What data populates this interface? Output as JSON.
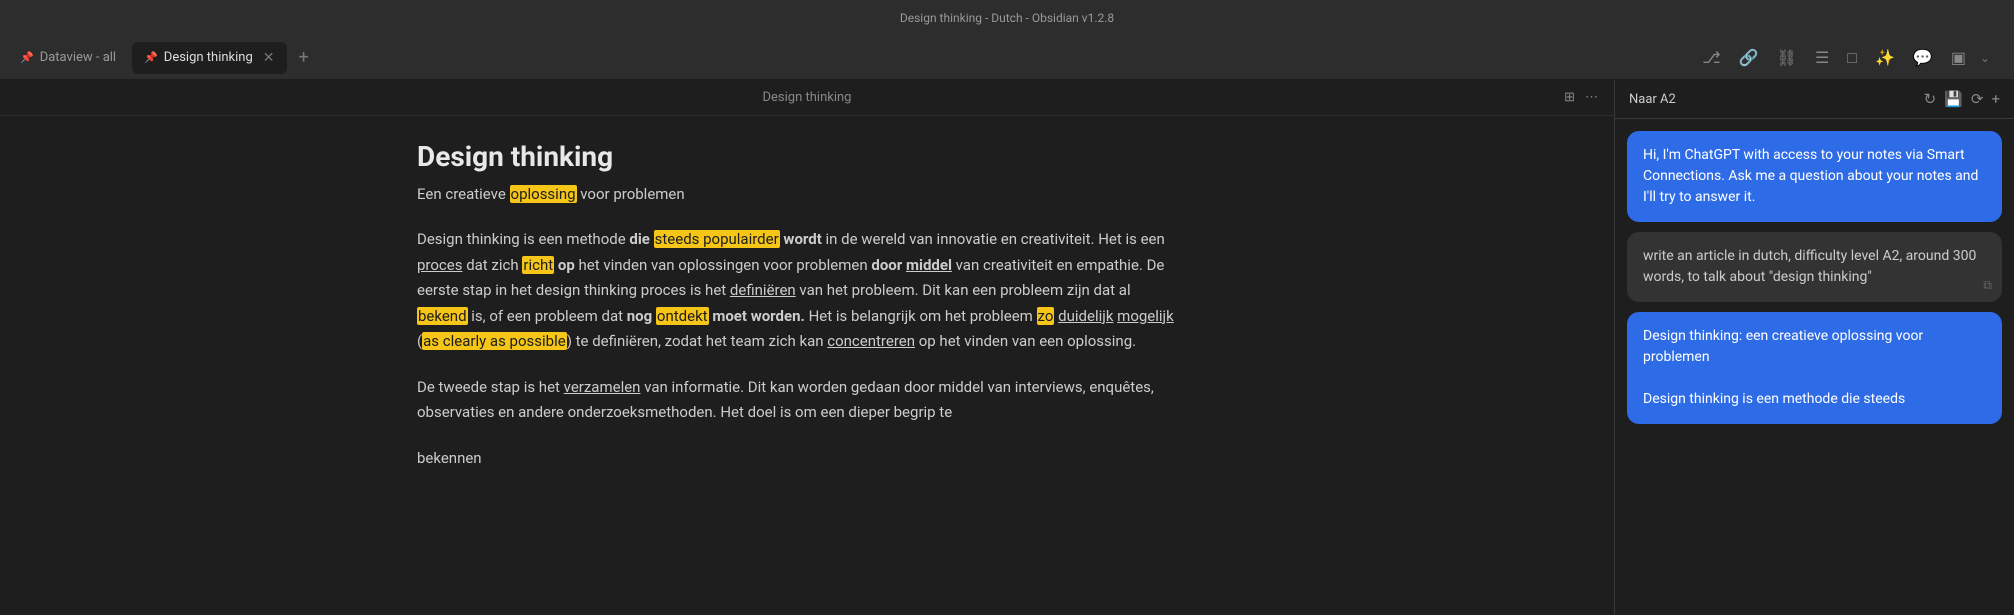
{
  "titlebar": {
    "text": "Design thinking - Dutch - Obsidian v1.2.8"
  },
  "tabs": [
    {
      "id": "tab-dataview",
      "label": "Dataview - all",
      "pinned": true,
      "active": false,
      "closeable": false
    },
    {
      "id": "tab-design-thinking",
      "label": "Design thinking",
      "pinned": true,
      "active": true,
      "closeable": true
    }
  ],
  "toolbar": {
    "new_tab_label": "+",
    "dropdown_label": "⌄",
    "icons": [
      "⎇",
      "🔗",
      "⛓",
      "☰",
      "□",
      "✨",
      "💬",
      "▣"
    ]
  },
  "editor": {
    "header_title": "Design thinking",
    "header_icons": [
      "⊞",
      "⋯"
    ]
  },
  "document": {
    "title": "Design thinking",
    "subtitle_prefix": "Een creatieve ",
    "subtitle_highlight": "oplossing",
    "subtitle_suffix": " voor problemen",
    "paragraphs": [
      {
        "id": "p1",
        "content": "Design thinking is een methode die steeds populairder wordt in de wereld van innovatie en creativiteit. Het is een proces dat zich richt op het vinden van oplossingen voor problemen door middel van creativiteit en empathie. De eerste stap in het design thinking proces is het definiëren van het probleem. Dit kan een probleem zijn dat al bekend is, of een probleem dat nog ontdekt moet worden. Het is belangrijk om het probleem zo duidelijk mogelijk (as clearly as possible) te definiëren, zodat het team zich kan concentreren op het vinden van een oplossing."
      },
      {
        "id": "p2",
        "content": "De tweede stap is het verzamelen van informatie. Dit kan worden gedaan door middel van interviews, enquêtes, observaties en andere onderzoeksmethoden. Het doel is om een dieper begrip te"
      },
      {
        "id": "p3",
        "content": "bekennen"
      }
    ]
  },
  "chat": {
    "header_title": "Naar A2",
    "header_icons": [
      "↻",
      "💾",
      "⟳",
      "+"
    ],
    "messages": [
      {
        "id": "msg1",
        "type": "ai",
        "text": "Hi, I'm ChatGPT with access to your notes via Smart Connections. Ask me a question about your notes and I'll try to answer it."
      },
      {
        "id": "msg2",
        "type": "user",
        "text": "write an article in dutch, difficulty level A2, around 300 words, to talk about \"design thinking\""
      },
      {
        "id": "msg3",
        "type": "response",
        "text": "Design thinking: een creatieve oplossing voor problemen\n\nDesign thinking is een methode die steeds"
      }
    ]
  }
}
